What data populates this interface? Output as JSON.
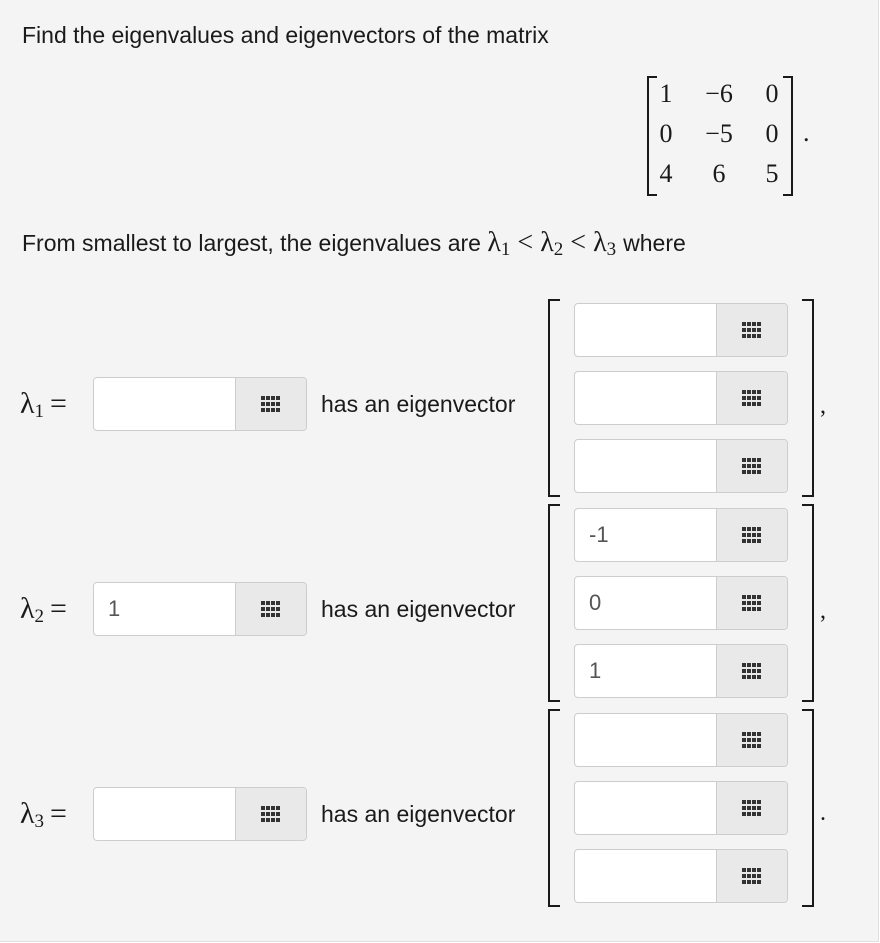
{
  "question": {
    "intro_text": "Find the eigenvalues and eigenvectors of the matrix",
    "matrix": [
      [
        "1",
        "−6",
        "0"
      ],
      [
        "0",
        "−5",
        "0"
      ],
      [
        "4",
        "6",
        "5"
      ]
    ],
    "matrix_end": ".",
    "order_prefix": "From smallest to largest, the eigenvalues are",
    "order_suffix": "where",
    "lambda_symbol": "λ",
    "less_than": "<",
    "equals": "="
  },
  "rows": [
    {
      "index": "1",
      "eigenvalue_value": "",
      "label": "has an eigenvector",
      "vector_values": [
        "",
        "",
        ""
      ],
      "punctuation": ","
    },
    {
      "index": "2",
      "eigenvalue_value": "1",
      "label": "has an eigenvector",
      "vector_values": [
        "-1",
        "0",
        "1"
      ],
      "punctuation": ","
    },
    {
      "index": "3",
      "eigenvalue_value": "",
      "label": "has an eigenvector",
      "vector_values": [
        "",
        "",
        ""
      ],
      "punctuation": "."
    }
  ],
  "icons": {
    "math_palette": "grid-keypad-icon"
  }
}
